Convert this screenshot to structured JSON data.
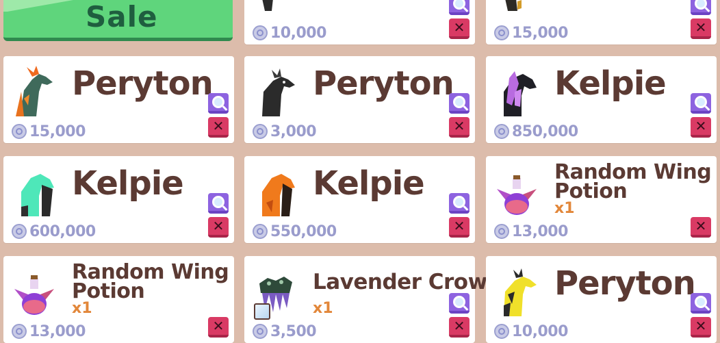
{
  "sale_button": {
    "label": "Sale"
  },
  "top_cards": [
    {
      "price": "10,000"
    },
    {
      "price": "15,000"
    }
  ],
  "cards": [
    {
      "title": "Peryton",
      "price": "15,000",
      "icon": "peryton-icon"
    },
    {
      "title": "Peryton",
      "price": "3,000",
      "icon": "peryton-icon"
    },
    {
      "title": "Kelpie",
      "price": "850,000",
      "icon": "kelpie-icon"
    },
    {
      "title": "Kelpie",
      "price": "600,000",
      "icon": "kelpie-icon"
    },
    {
      "title": "Kelpie",
      "price": "550,000",
      "icon": "kelpie-icon"
    },
    {
      "title_line1": "Random Wing",
      "title_line2": "Potion",
      "qty": "x1",
      "price": "13,000",
      "icon": "potion-icon"
    },
    {
      "title_line1": "Random Wing",
      "title_line2": "Potion",
      "qty": "x1",
      "price": "13,000",
      "icon": "potion-icon"
    },
    {
      "title": "Lavender Crown",
      "qty": "x1",
      "price": "3,500",
      "icon": "crown-icon"
    },
    {
      "title": "Peryton",
      "price": "10,000",
      "icon": "peryton-icon"
    }
  ],
  "colors": {
    "background": "#dcbcab",
    "title": "#5b3a33",
    "price": "#9a9ccc",
    "qty": "#e2873a",
    "inspect_button": "#8d63e0",
    "remove_button": "#d93a64",
    "sale_button": "#5fd57c"
  }
}
